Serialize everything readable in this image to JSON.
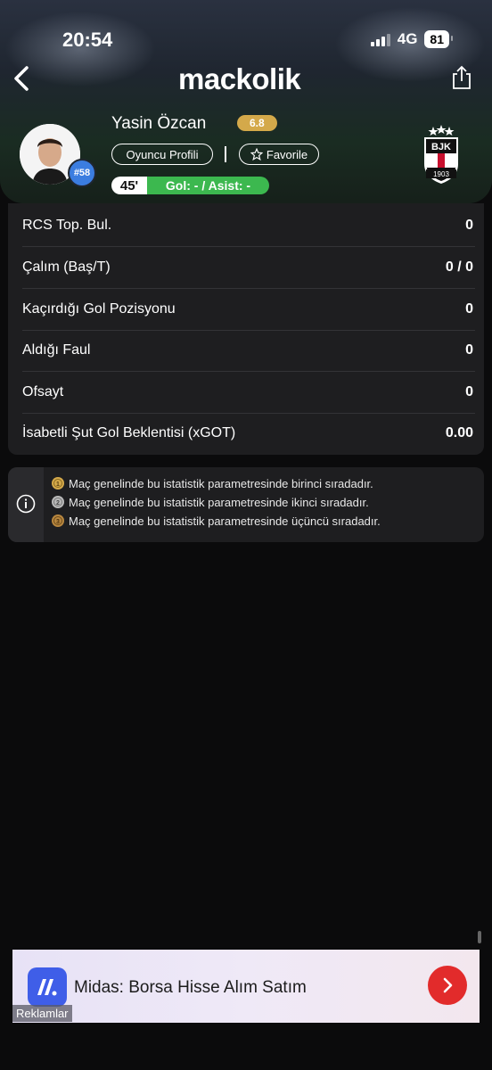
{
  "status": {
    "time": "20:54",
    "network": "4G",
    "battery": "81"
  },
  "header": {
    "logo": "mackolik"
  },
  "player": {
    "name": "Yasin Özcan",
    "rating": "6.8",
    "number": "#58",
    "profile_button": "Oyuncu Profili",
    "favorite_button": "Favorile",
    "minute": "45'",
    "goal_assist": "Gol: - / Asist: -"
  },
  "club": {
    "logo_text": "1903"
  },
  "stats": [
    {
      "label": "RCS Top. Bul.",
      "value": "0"
    },
    {
      "label": "Çalım (Baş/T)",
      "value": "0 / 0"
    },
    {
      "label": "Kaçırdığı Gol Pozisyonu",
      "value": "0"
    },
    {
      "label": "Aldığı Faul",
      "value": "0"
    },
    {
      "label": "Ofsayt",
      "value": "0"
    },
    {
      "label": "İsabetli Şut Gol Beklentisi (xGOT)",
      "value": "0.00"
    }
  ],
  "legend": [
    {
      "medal": "gold-medal-icon",
      "color": "#d4a94a",
      "text": "Maç genelinde bu istatistik parametresinde birinci sıradadır."
    },
    {
      "medal": "silver-medal-icon",
      "color": "#b9b9b9",
      "text": "Maç genelinde bu istatistik parametresinde ikinci sıradadır."
    },
    {
      "medal": "bronze-medal-icon",
      "color": "#b8873f",
      "text": "Maç genelinde bu istatistik parametresinde üçüncü sıradadır."
    }
  ],
  "ad": {
    "title": "Midas: Borsa Hisse Alım Satım",
    "label": "Reklamlar"
  },
  "colors": {
    "rating": "#d4a94a",
    "goal_pill": "#3cb84f",
    "number_badge": "#3b7de0",
    "ad_button": "#e22b2b"
  }
}
